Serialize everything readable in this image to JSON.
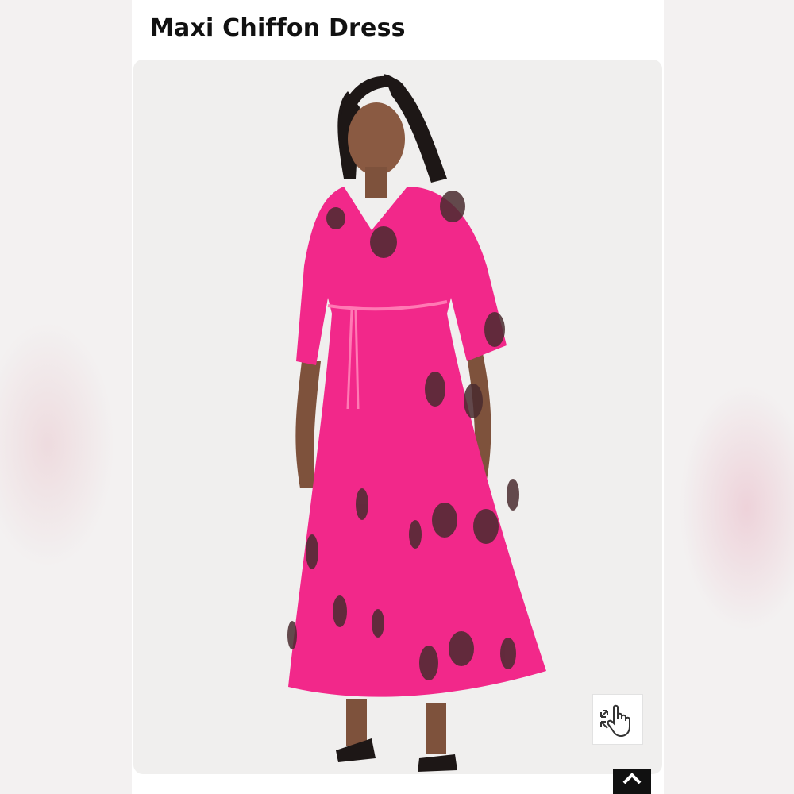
{
  "product": {
    "title": "Maxi Chiffon Dress"
  },
  "image": {
    "subject": "Model wearing a pink maxi chiffon dress with skull print",
    "dress_color": "#f2288a",
    "background_color": "#f0efee"
  },
  "controls": {
    "zoom_icon": "hand-pointer-zoom-icon",
    "back_to_top_icon": "chevron-up-icon"
  },
  "colors": {
    "title": "#111111",
    "panel": "#ffffff",
    "top_button": "#111111"
  }
}
